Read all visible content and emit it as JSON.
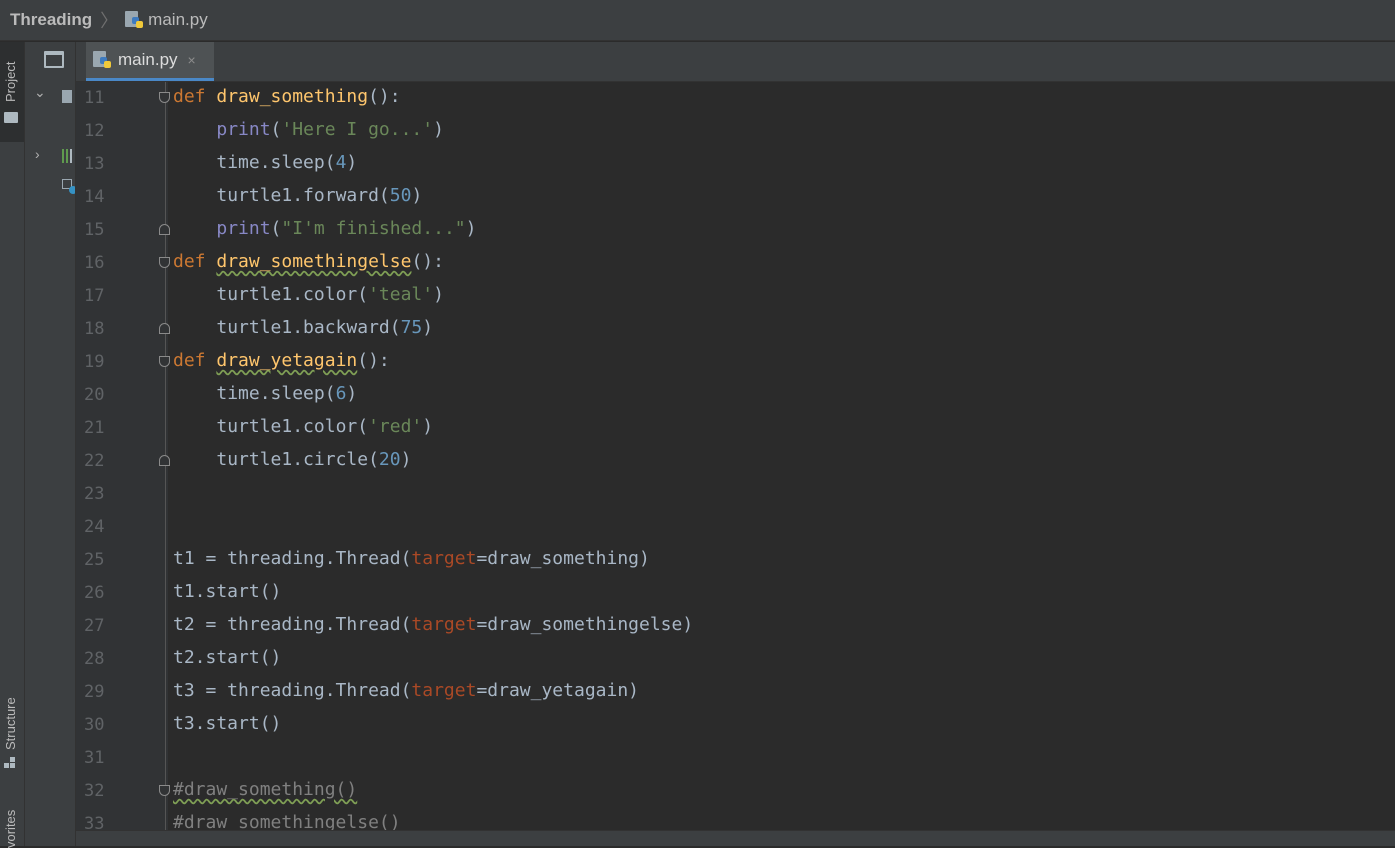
{
  "breadcrumb": {
    "project": "Threading",
    "file": "main.py"
  },
  "tool_strip": {
    "project_tab": "Project",
    "structure_tab": "Structure",
    "favorites_tab": "vorites"
  },
  "editor": {
    "tab_label": "main.py",
    "tab_close": "×",
    "lines": [
      {
        "n": "11"
      },
      {
        "n": "12"
      },
      {
        "n": "13"
      },
      {
        "n": "14"
      },
      {
        "n": "15"
      },
      {
        "n": "16"
      },
      {
        "n": "17"
      },
      {
        "n": "18"
      },
      {
        "n": "19"
      },
      {
        "n": "20"
      },
      {
        "n": "21"
      },
      {
        "n": "22"
      },
      {
        "n": "23"
      },
      {
        "n": "24"
      },
      {
        "n": "25"
      },
      {
        "n": "26"
      },
      {
        "n": "27"
      },
      {
        "n": "28"
      },
      {
        "n": "29"
      },
      {
        "n": "30"
      },
      {
        "n": "31"
      },
      {
        "n": "32"
      },
      {
        "n": "33"
      }
    ],
    "code": {
      "l11": {
        "kw": "def",
        "fn": "draw_something",
        "rest": "():"
      },
      "l12": {
        "bi": "print",
        "a": "(",
        "str": "'Here I go...'",
        "b": ")"
      },
      "l13": {
        "a": "time.sleep(",
        "num": "4",
        "b": ")"
      },
      "l14": {
        "a": "turtle1.forward(",
        "num": "50",
        "b": ")"
      },
      "l15": {
        "bi": "print",
        "a": "(",
        "str": "\"I'm finished...\"",
        "b": ")"
      },
      "l16": {
        "kw": "def",
        "fn": "draw_somethingelse",
        "rest": "():"
      },
      "l17": {
        "a": "turtle1.color(",
        "str": "'teal'",
        "b": ")"
      },
      "l18": {
        "a": "turtle1.backward(",
        "num": "75",
        "b": ")"
      },
      "l19": {
        "kw": "def",
        "fn": "draw_yetagain",
        "rest": "():"
      },
      "l20": {
        "a": "time.sleep(",
        "num": "6",
        "b": ")"
      },
      "l21": {
        "a": "turtle1.color(",
        "str": "'red'",
        "b": ")"
      },
      "l22": {
        "a": "turtle1.circle(",
        "num": "20",
        "b": ")"
      },
      "l25": {
        "a": "t1 = threading.Thread(",
        "param": "target",
        "b": "=draw_something)"
      },
      "l26": {
        "a": "t1.start()"
      },
      "l27": {
        "a": "t2 = threading.Thread(",
        "param": "target",
        "b": "=draw_somethingelse)"
      },
      "l28": {
        "a": "t2.start()"
      },
      "l29": {
        "a": "t3 = threading.Thread(",
        "param": "target",
        "b": "=draw_yetagain)"
      },
      "l30": {
        "a": "t3.start()"
      },
      "l32": {
        "cmt": "#draw_something()"
      },
      "l33": {
        "cmt": "#draw_somethingelse()"
      }
    }
  },
  "colors": {
    "keyword": "#cc7832",
    "function": "#ffc66d",
    "builtin": "#8888c6",
    "string": "#6a8759",
    "number": "#6897bb",
    "param": "#aa4926",
    "comment": "#808080",
    "tab_underline": "#4a88c7"
  },
  "icons": [
    "python-file-icon",
    "folder-icon",
    "structure-icon",
    "chevron-down-icon",
    "chevron-right-icon",
    "library-icon",
    "scratches-icon"
  ]
}
